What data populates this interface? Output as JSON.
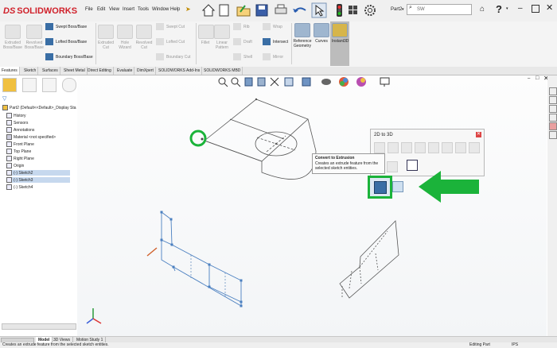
{
  "app": {
    "logo": "SOLIDWORKS",
    "logo_prefix": "DS",
    "menus": [
      "File",
      "Edit",
      "View",
      "Insert",
      "Tools",
      "Window",
      "Help"
    ],
    "document_name": "Part2",
    "search_placeholder": "SW"
  },
  "command_manager": {
    "buttons": [
      {
        "label": "Extruded Boss/Base",
        "enabled": false
      },
      {
        "label": "Revolved Boss/Base",
        "enabled": false
      },
      {
        "label": "Swept Boss/Base",
        "enabled": true
      },
      {
        "label": "Lofted Boss/Base",
        "enabled": true
      },
      {
        "label": "Boundary Boss/Base",
        "enabled": true
      },
      {
        "label": "Extruded Cut",
        "enabled": false
      },
      {
        "label": "Hole Wizard",
        "enabled": false
      },
      {
        "label": "Revolved Cut",
        "enabled": false
      },
      {
        "label": "Swept Cut",
        "enabled": false
      },
      {
        "label": "Lofted Cut",
        "enabled": false
      },
      {
        "label": "Boundary Cut",
        "enabled": false
      },
      {
        "label": "Fillet",
        "enabled": false
      },
      {
        "label": "Linear Pattern",
        "enabled": false
      },
      {
        "label": "Rib",
        "enabled": false
      },
      {
        "label": "Draft",
        "enabled": false
      },
      {
        "label": "Shell",
        "enabled": false
      },
      {
        "label": "Wrap",
        "enabled": false
      },
      {
        "label": "Intersect",
        "enabled": true
      },
      {
        "label": "Mirror",
        "enabled": false
      },
      {
        "label": "Reference Geometry",
        "enabled": true
      },
      {
        "label": "Curves",
        "enabled": true
      },
      {
        "label": "Instant3D",
        "enabled": true
      }
    ]
  },
  "tabs": [
    "Features",
    "Sketch",
    "Surfaces",
    "Sheet Metal",
    "Direct Editing",
    "Evaluate",
    "DimXpert",
    "SOLIDWORKS Add-Ins",
    "SOLIDWORKS MBD"
  ],
  "tree": {
    "root": "Part2 (Default<<Default>_Display Sta",
    "items": [
      {
        "label": "History",
        "selected": false
      },
      {
        "label": "Sensors",
        "selected": false
      },
      {
        "label": "Annotations",
        "selected": false
      },
      {
        "label": "Material <not specified>",
        "selected": false
      },
      {
        "label": "Front Plane",
        "selected": false
      },
      {
        "label": "Top Plane",
        "selected": false
      },
      {
        "label": "Right Plane",
        "selected": false
      },
      {
        "label": "Origin",
        "selected": false
      },
      {
        "label": "(-) Sketch2",
        "selected": true
      },
      {
        "label": "(-) Sketch3",
        "selected": true
      },
      {
        "label": "(-) Sketch4",
        "selected": false
      }
    ]
  },
  "toolbar_2d3d": {
    "title": "2D to 3D",
    "tooltip_title": "Convert to Extrusion",
    "tooltip_desc": "Creates an extrude feature from the selected sketch entities."
  },
  "bottom_tabs": [
    "Model",
    "3D Views",
    "Motion Study 1"
  ],
  "status": {
    "message": "Creates an extrude feature from the selected sketch entities.",
    "mode": "Editing Part",
    "units": "IPS"
  },
  "colors": {
    "highlight_green": "#1bb33a",
    "brand_red": "#d0202a",
    "selection_blue": "#4a7fc0"
  }
}
